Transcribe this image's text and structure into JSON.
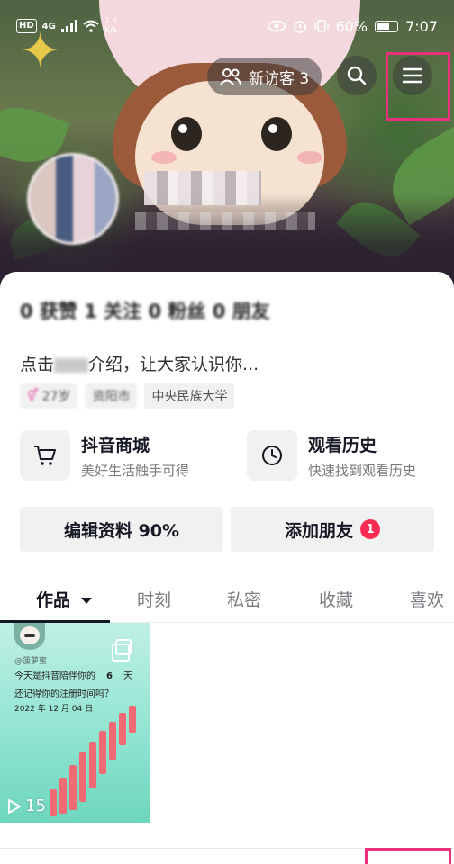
{
  "status_bar": {
    "hd": "HD",
    "network": "4G",
    "speed_value": "7.5",
    "speed_unit": "K/s",
    "battery": "60%",
    "time": "7:07"
  },
  "header": {
    "new_visitors_label": "新访客 3",
    "search_icon": "search-icon",
    "menu_icon": "menu-icon"
  },
  "profile": {
    "stats_blurred": "0 获赞  1 关注  0 粉丝  0 朋友",
    "bio_prefix": "点击",
    "bio_middle": "介绍，让大家认识你...",
    "tags": [
      {
        "label": "27岁",
        "icon": "gender-icon"
      },
      {
        "label": "资阳市"
      },
      {
        "label": "中央民族大学"
      }
    ]
  },
  "shortcuts": [
    {
      "title": "抖音商城",
      "subtitle": "美好生活触手可得",
      "icon": "cart-icon"
    },
    {
      "title": "观看历史",
      "subtitle": "快速找到观看历史",
      "icon": "clock-icon"
    }
  ],
  "actions": {
    "edit_profile": "编辑资料 90%",
    "add_friend": "添加朋友",
    "add_friend_badge": "1"
  },
  "tabs": [
    {
      "label": "作品",
      "active": true
    },
    {
      "label": "时刻"
    },
    {
      "label": "私密"
    },
    {
      "label": "收藏"
    },
    {
      "label": "喜欢"
    }
  ],
  "post": {
    "handle": "@菠萝蜜",
    "line1": "今天是抖音陪伴你的",
    "days": "6",
    "days_unit": "天",
    "line2": "还记得你的注册时间吗？",
    "date": "2022 年 12 月 04 日",
    "play_count": "15"
  }
}
